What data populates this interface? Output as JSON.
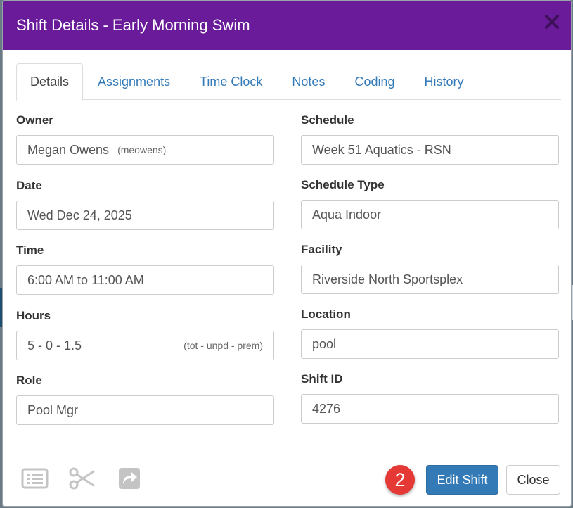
{
  "modal": {
    "title": "Shift Details - Early Morning Swim",
    "close_icon": "close-x-icon"
  },
  "tabs": [
    {
      "label": "Details",
      "active": true
    },
    {
      "label": "Assignments"
    },
    {
      "label": "Time Clock"
    },
    {
      "label": "Notes"
    },
    {
      "label": "Coding"
    },
    {
      "label": "History"
    }
  ],
  "fields": {
    "owner": {
      "label": "Owner",
      "value": "Megan Owens",
      "username": "(meowens)"
    },
    "date": {
      "label": "Date",
      "value": "Wed Dec 24, 2025"
    },
    "time": {
      "label": "Time",
      "value": "6:00 AM to 11:00 AM"
    },
    "hours": {
      "label": "Hours",
      "value": "5 - 0 - 1.5",
      "hint": "(tot - unpd - prem)"
    },
    "role": {
      "label": "Role",
      "value": "Pool Mgr"
    },
    "schedule": {
      "label": "Schedule",
      "value": "Week 51 Aquatics - RSN"
    },
    "schedule_type": {
      "label": "Schedule Type",
      "value": "Aqua Indoor"
    },
    "facility": {
      "label": "Facility",
      "value": "Riverside North Sportsplex"
    },
    "location": {
      "label": "Location",
      "value": "pool"
    },
    "shift_id": {
      "label": "Shift ID",
      "value": "4276"
    }
  },
  "footer": {
    "icons": [
      "list-icon",
      "scissors-icon",
      "share-arrow-icon"
    ],
    "step_badge": "2",
    "edit_label": "Edit Shift",
    "close_label": "Close"
  },
  "colors": {
    "header": "#6a1b9a",
    "primary": "#337ab7",
    "badge": "#e53935",
    "tab_link": "#337ab7"
  }
}
